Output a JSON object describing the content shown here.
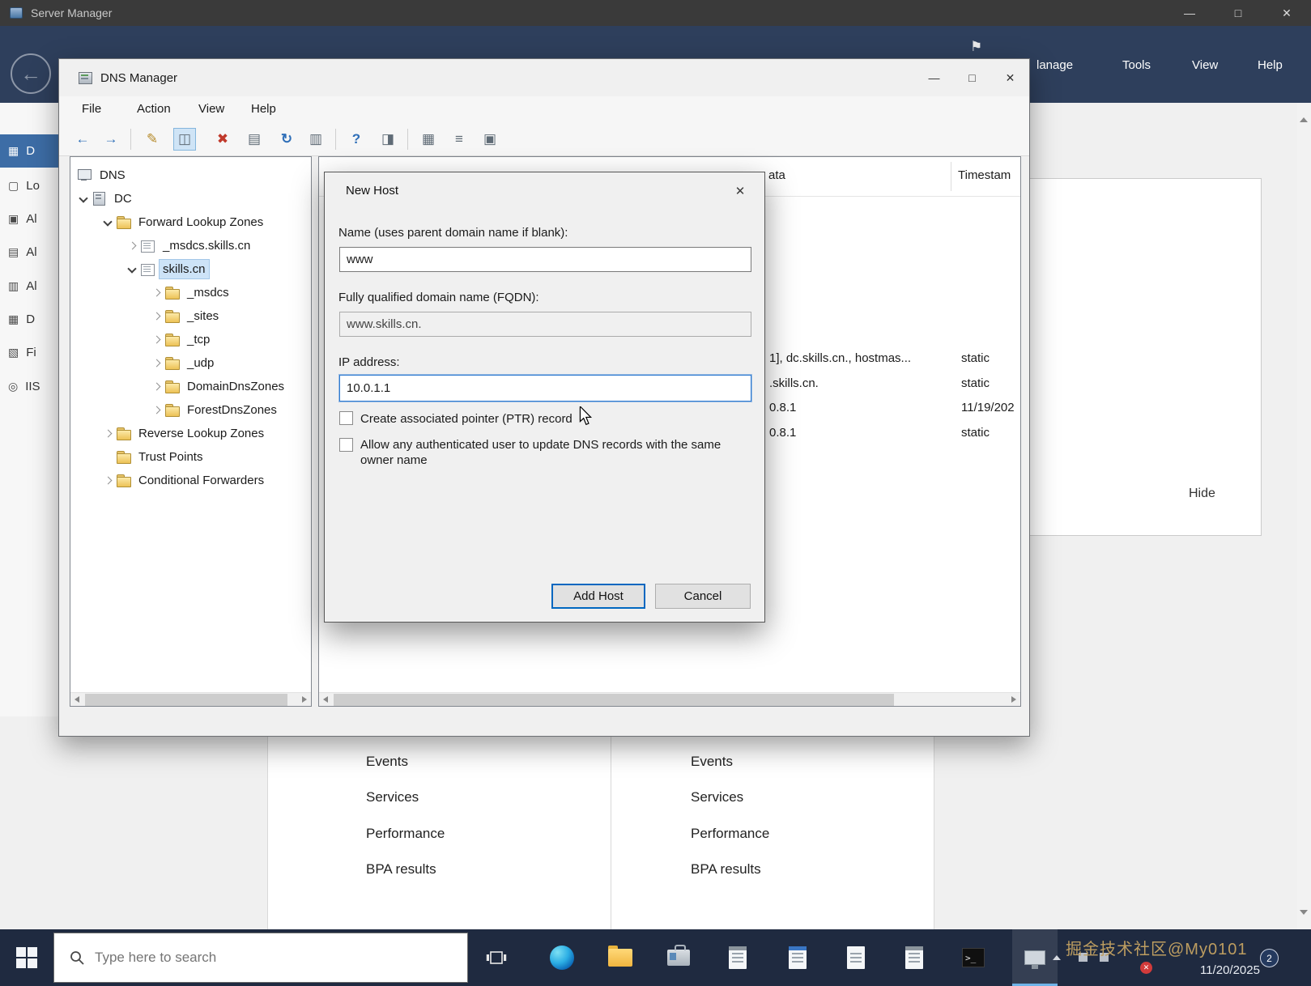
{
  "server_manager": {
    "title": "Server Manager",
    "nav_menu": [
      "lanage",
      "Tools",
      "View",
      "Help"
    ],
    "sidebar": [
      "D",
      "Lo",
      "Al",
      "Al",
      "Al",
      "D",
      "Fi",
      "IIS"
    ],
    "tiles": {
      "left_links": [
        "Events",
        "Services",
        "Performance",
        "BPA results"
      ],
      "right_links": [
        "Events",
        "Services",
        "Performance",
        "BPA results"
      ]
    },
    "hide_label": "Hide"
  },
  "dns_manager": {
    "title": "DNS Manager",
    "menu": [
      "File",
      "Action",
      "View",
      "Help"
    ],
    "tree": [
      {
        "label": "DNS"
      },
      {
        "label": "DC"
      },
      {
        "label": "Forward Lookup Zones"
      },
      {
        "label": "_msdcs.skills.cn"
      },
      {
        "label": "skills.cn"
      },
      {
        "label": "_msdcs"
      },
      {
        "label": "_sites"
      },
      {
        "label": "_tcp"
      },
      {
        "label": "_udp"
      },
      {
        "label": "DomainDnsZones"
      },
      {
        "label": "ForestDnsZones"
      },
      {
        "label": "Reverse Lookup Zones"
      },
      {
        "label": "Trust Points"
      },
      {
        "label": "Conditional Forwarders"
      }
    ],
    "grid": {
      "columns": [
        "ata",
        "Timestam"
      ],
      "rows": [
        {
          "data": "1], dc.skills.cn., hostmas...",
          "timestamp": "static"
        },
        {
          "data": ".skills.cn.",
          "timestamp": "static"
        },
        {
          "data": "0.8.1",
          "timestamp": "11/19/202"
        },
        {
          "data": "0.8.1",
          "timestamp": "static"
        }
      ]
    }
  },
  "dialog": {
    "title": "New Host",
    "name_label": "Name (uses parent domain name if blank):",
    "name_value": "www",
    "fqdn_label": "Fully qualified domain name (FQDN):",
    "fqdn_value": "www.skills.cn.",
    "ip_label": "IP address:",
    "ip_value": "10.0.1.1",
    "ptr_label": "Create associated pointer (PTR) record",
    "acl_label": "Allow any authenticated user to update DNS records with the same owner name",
    "add_label": "Add Host",
    "cancel_label": "Cancel"
  },
  "taskbar": {
    "search_placeholder": "Type here to search",
    "date": "11/20/2025",
    "watermark": "掘金技术社区@My0101",
    "notification_badge": "2",
    "cmd_glyph": ">_"
  },
  "glyphs": {
    "minimize": "—",
    "maximize": "□",
    "close": "✕",
    "back": "←",
    "forward": "→",
    "flag": "⚑",
    "help": "?",
    "toolbar_wizard": "✎",
    "toolbar_console_tree": "◫",
    "toolbar_delete": "✖",
    "toolbar_properties": "▤",
    "toolbar_refresh": "↻",
    "toolbar_export": "▥",
    "toolbar_window": "◨",
    "toolbar_record": "▦",
    "toolbar_list": "≡",
    "toolbar_clipboard": "▣",
    "sidebar_icons": [
      "▦",
      "▢",
      "▣",
      "▤",
      "▥",
      "▦",
      "▧",
      "◎"
    ]
  }
}
